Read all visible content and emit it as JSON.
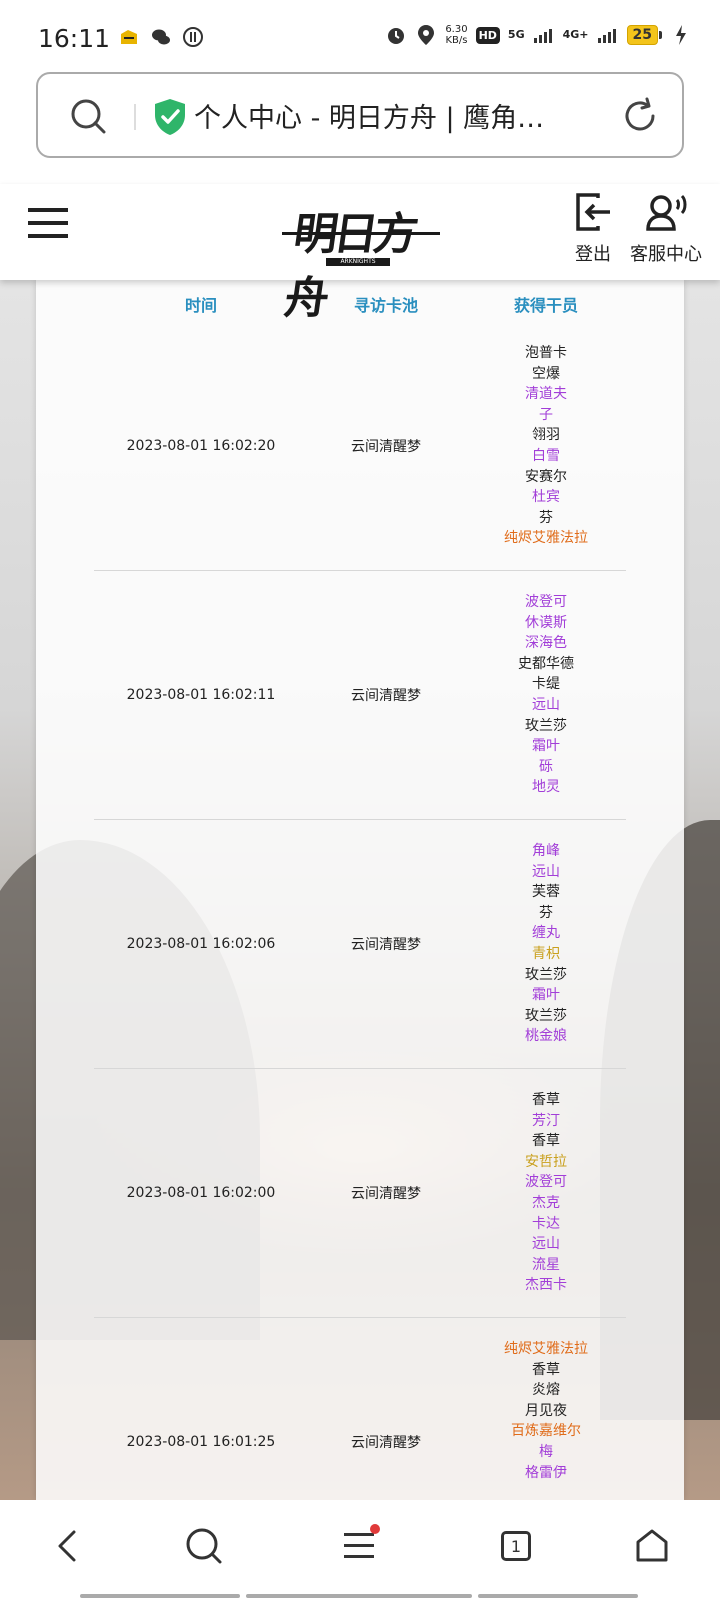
{
  "status_bar": {
    "time": "16:11",
    "net_speed_value": "6.30",
    "net_speed_unit": "KB/s",
    "hd_label": "HD",
    "signal_1": "5G",
    "signal_2": "4G+",
    "battery": "25",
    "left_icons": [
      "notification-icon",
      "wechat-icon",
      "app-icon"
    ],
    "right_icons": [
      "alarm-icon",
      "location-icon",
      "charging-icon"
    ]
  },
  "address_bar": {
    "title": "个人中心 - 明日方舟 | 鹰角…"
  },
  "site_header": {
    "logo_text": "明日方舟",
    "logo_sub": "ARKNIGHTS",
    "logout_label": "登出",
    "service_label": "客服中心"
  },
  "table": {
    "headers": {
      "time": "时间",
      "pool": "寻访卡池",
      "operators": "获得干员"
    },
    "rows": [
      {
        "time": "2023-08-01 16:02:20",
        "pool": "云间清醒梦",
        "operators": [
          {
            "name": "泡普卡",
            "rarity": "r3"
          },
          {
            "name": "空爆",
            "rarity": "r3"
          },
          {
            "name": "清道夫",
            "rarity": "r4"
          },
          {
            "name": "子",
            "rarity": "r4"
          },
          {
            "name": "翎羽",
            "rarity": "r3"
          },
          {
            "name": "白雪",
            "rarity": "r4"
          },
          {
            "name": "安赛尔",
            "rarity": "r3"
          },
          {
            "name": "杜宾",
            "rarity": "r4"
          },
          {
            "name": "芬",
            "rarity": "r3"
          },
          {
            "name": "纯烬艾雅法拉",
            "rarity": "r6"
          }
        ]
      },
      {
        "time": "2023-08-01 16:02:11",
        "pool": "云间清醒梦",
        "operators": [
          {
            "name": "波登可",
            "rarity": "r4"
          },
          {
            "name": "休谟斯",
            "rarity": "r4"
          },
          {
            "name": "深海色",
            "rarity": "r4"
          },
          {
            "name": "史都华德",
            "rarity": "r3"
          },
          {
            "name": "卡缇",
            "rarity": "r3"
          },
          {
            "name": "远山",
            "rarity": "r4"
          },
          {
            "name": "玫兰莎",
            "rarity": "r3"
          },
          {
            "name": "霜叶",
            "rarity": "r4"
          },
          {
            "name": "砾",
            "rarity": "r4"
          },
          {
            "name": "地灵",
            "rarity": "r4"
          }
        ]
      },
      {
        "time": "2023-08-01 16:02:06",
        "pool": "云间清醒梦",
        "operators": [
          {
            "name": "角峰",
            "rarity": "r4"
          },
          {
            "name": "远山",
            "rarity": "r4"
          },
          {
            "name": "芙蓉",
            "rarity": "r3"
          },
          {
            "name": "芬",
            "rarity": "r3"
          },
          {
            "name": "缠丸",
            "rarity": "r4"
          },
          {
            "name": "青枳",
            "rarity": "r5"
          },
          {
            "name": "玫兰莎",
            "rarity": "r3"
          },
          {
            "name": "霜叶",
            "rarity": "r4"
          },
          {
            "name": "玫兰莎",
            "rarity": "r3"
          },
          {
            "name": "桃金娘",
            "rarity": "r4"
          }
        ]
      },
      {
        "time": "2023-08-01 16:02:00",
        "pool": "云间清醒梦",
        "operators": [
          {
            "name": "香草",
            "rarity": "r3"
          },
          {
            "name": "芳汀",
            "rarity": "r4"
          },
          {
            "name": "香草",
            "rarity": "r3"
          },
          {
            "name": "安哲拉",
            "rarity": "r5"
          },
          {
            "name": "波登可",
            "rarity": "r4"
          },
          {
            "name": "杰克",
            "rarity": "r4"
          },
          {
            "name": "卡达",
            "rarity": "r4"
          },
          {
            "name": "远山",
            "rarity": "r4"
          },
          {
            "name": "流星",
            "rarity": "r4"
          },
          {
            "name": "杰西卡",
            "rarity": "r4"
          }
        ]
      },
      {
        "time": "2023-08-01 16:01:25",
        "pool": "云间清醒梦",
        "operators": [
          {
            "name": "纯烬艾雅法拉",
            "rarity": "r6"
          },
          {
            "name": "香草",
            "rarity": "r3"
          },
          {
            "name": "炎熔",
            "rarity": "r3"
          },
          {
            "name": "月见夜",
            "rarity": "r3"
          },
          {
            "name": "百炼嘉维尔",
            "rarity": "r6"
          },
          {
            "name": "梅",
            "rarity": "r4"
          },
          {
            "name": "格雷伊",
            "rarity": "r4"
          },
          {
            "name": "",
            "rarity": "r3"
          },
          {
            "name": "",
            "rarity": "r3"
          },
          {
            "name": "",
            "rarity": "r3"
          }
        ]
      }
    ]
  },
  "colors": {
    "header_blue": "#2a8fbf",
    "six_star": "#e06c1a",
    "five_star": "#c9a01d",
    "four_star": "#a23ed8",
    "three_star": "#222222"
  },
  "bottom_nav": {
    "tab_count": "1",
    "icons": [
      "back-icon",
      "search-icon",
      "menu-icon",
      "tabs-icon",
      "home-icon"
    ]
  }
}
